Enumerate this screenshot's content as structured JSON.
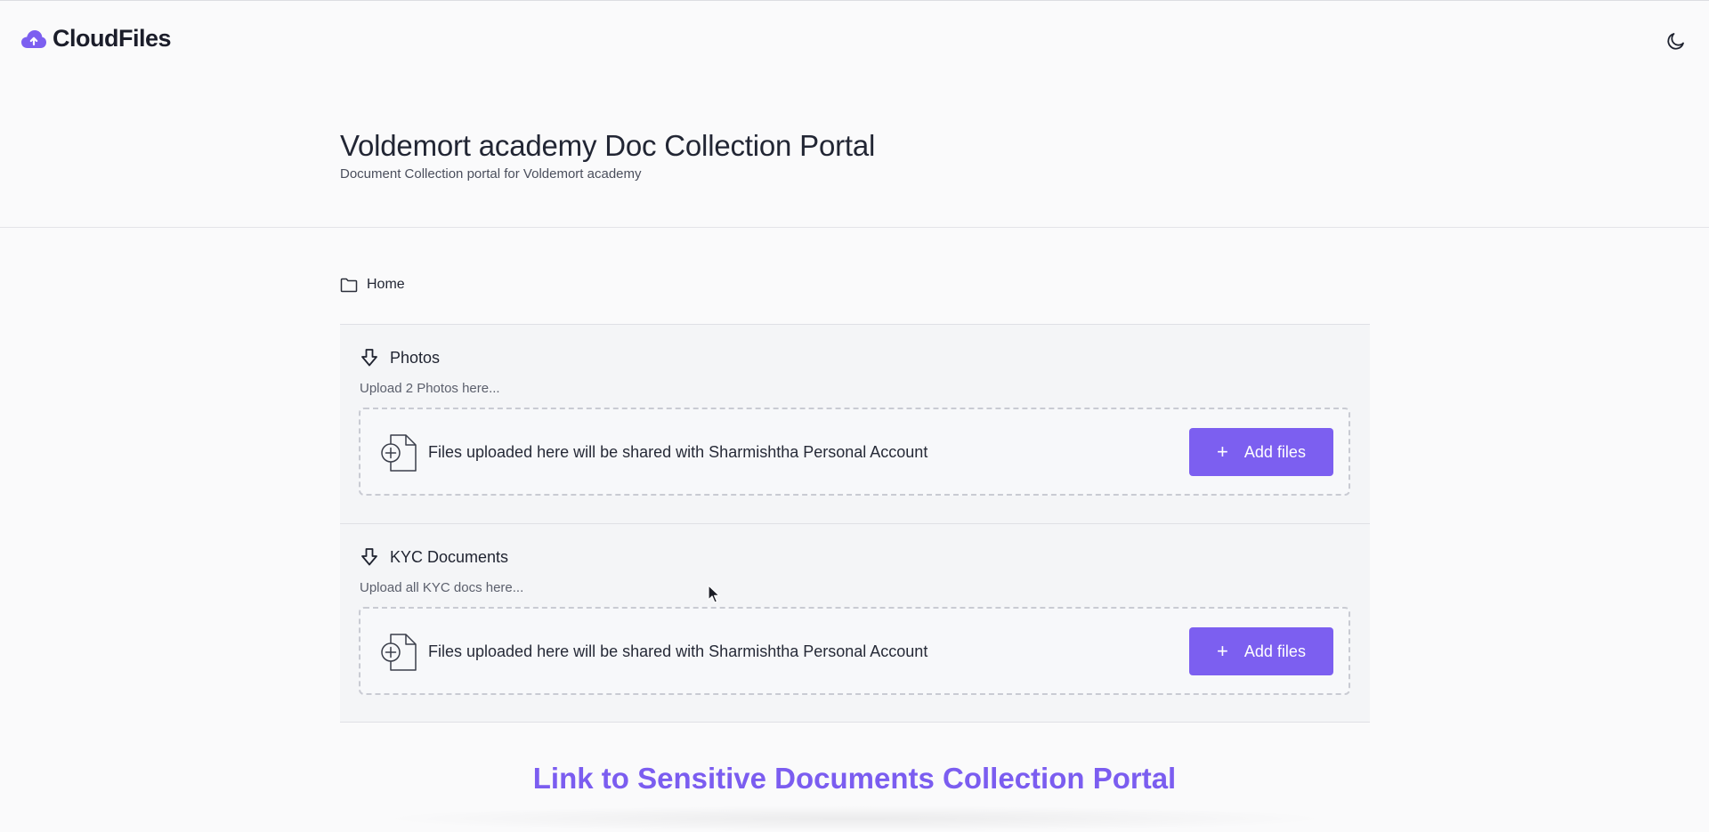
{
  "app": {
    "name": "CloudFiles",
    "accent_color": "#7c5ff0"
  },
  "navbar": {
    "theme_toggle_icon": "moon-icon"
  },
  "portal": {
    "title": "Voldemort academy Doc Collection Portal",
    "subtitle": "Document Collection portal for Voldemort academy"
  },
  "breadcrumb": {
    "icon": "folder-icon",
    "label": "Home"
  },
  "sections": [
    {
      "icon": "download-arrow-icon",
      "title": "Photos",
      "description": "Upload 2 Photos here...",
      "dropzone_text": "Files uploaded here will be shared with Sharmishtha Personal Account",
      "button_label": "Add files"
    },
    {
      "icon": "download-arrow-icon",
      "title": "KYC Documents",
      "description": "Upload all KYC docs here...",
      "dropzone_text": "Files uploaded here will be shared with Sharmishtha Personal Account",
      "button_label": "Add files"
    }
  ],
  "footer_link": {
    "label": "Link to Sensitive Documents Collection Portal",
    "color": "#7b5df0"
  }
}
